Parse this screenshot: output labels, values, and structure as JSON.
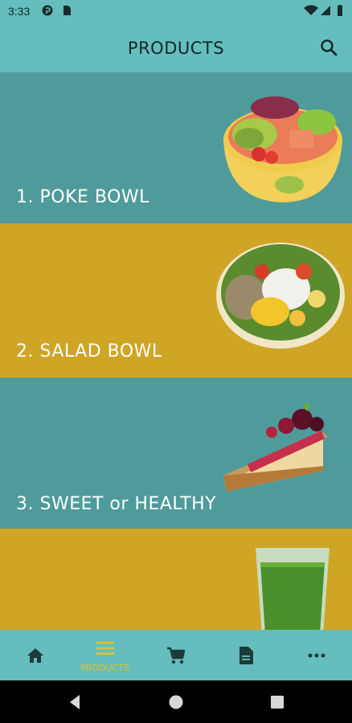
{
  "status_bar": {
    "time": "3:33"
  },
  "header": {
    "title": "PRODUCTS",
    "search_icon": "search-icon"
  },
  "products": [
    {
      "label": "1. POKE BOWL",
      "bg": "#4f9b9b",
      "image": "poke-bowl"
    },
    {
      "label": "2. SALAD BOWL",
      "bg": "#cfa526",
      "image": "salad-bowl"
    },
    {
      "label": "3. SWEET or HEALTHY",
      "bg": "#4f9b9b",
      "image": "cheesecake-slice"
    },
    {
      "label": "",
      "bg": "#cfa526",
      "image": "green-juice"
    }
  ],
  "tabs": [
    {
      "icon": "home-icon",
      "label": ""
    },
    {
      "icon": "menu-icon",
      "label": "PRODUCTS"
    },
    {
      "icon": "cart-icon",
      "label": ""
    },
    {
      "icon": "document-icon",
      "label": ""
    },
    {
      "icon": "more-icon",
      "label": ""
    }
  ],
  "colors": {
    "teal_header": "#65bdbd",
    "teal_card": "#4f9b9b",
    "mustard_card": "#cfa526",
    "active_tab": "#e2c22c"
  }
}
